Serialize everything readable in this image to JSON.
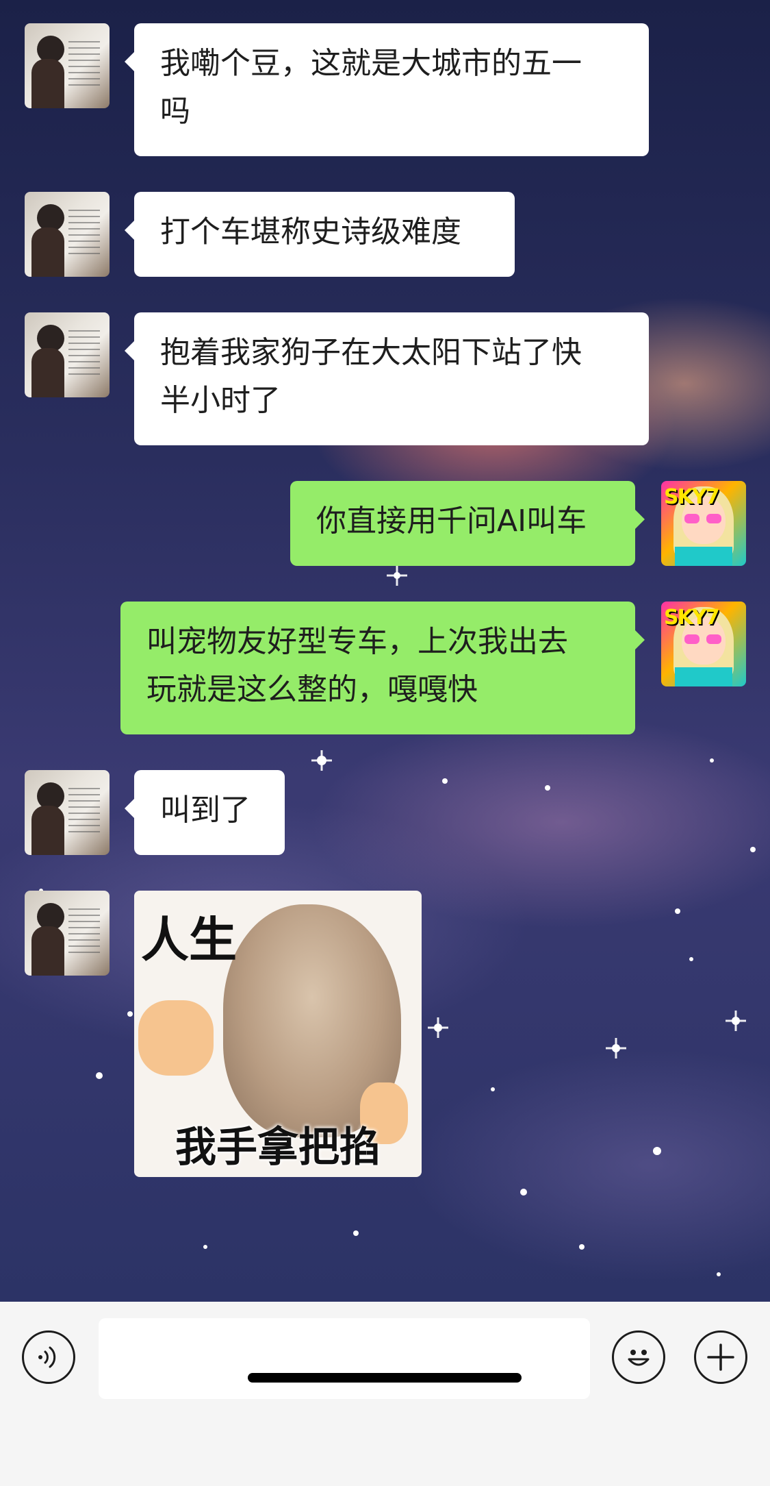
{
  "messages": [
    {
      "side": "left",
      "type": "text",
      "text": "我嘞个豆，这就是大城市的五一\n吗"
    },
    {
      "side": "left",
      "type": "text",
      "text": "打个车堪称史诗级难度"
    },
    {
      "side": "left",
      "type": "text",
      "text": "抱着我家狗子在大太阳下站了快\n半小时了"
    },
    {
      "side": "right",
      "type": "text",
      "text": "你直接用千问AI叫车"
    },
    {
      "side": "right",
      "type": "text",
      "text": "叫宠物友好型专车，上次我出去\n玩就是这么整的，嘎嘎快"
    },
    {
      "side": "left",
      "type": "text",
      "text": "叫到了"
    },
    {
      "side": "left",
      "type": "sticker",
      "top_text": "人生",
      "bottom_text": "我手拿把掐"
    }
  ],
  "my_avatar_text": "SKY7",
  "input": {
    "value": "",
    "placeholder": ""
  },
  "icons": {
    "voice": "voice-icon",
    "emoji": "emoji-icon",
    "plus": "plus-icon"
  },
  "colors": {
    "my_bubble": "#95ec69",
    "friend_bubble": "#ffffff",
    "input_bar": "#f5f5f5"
  }
}
